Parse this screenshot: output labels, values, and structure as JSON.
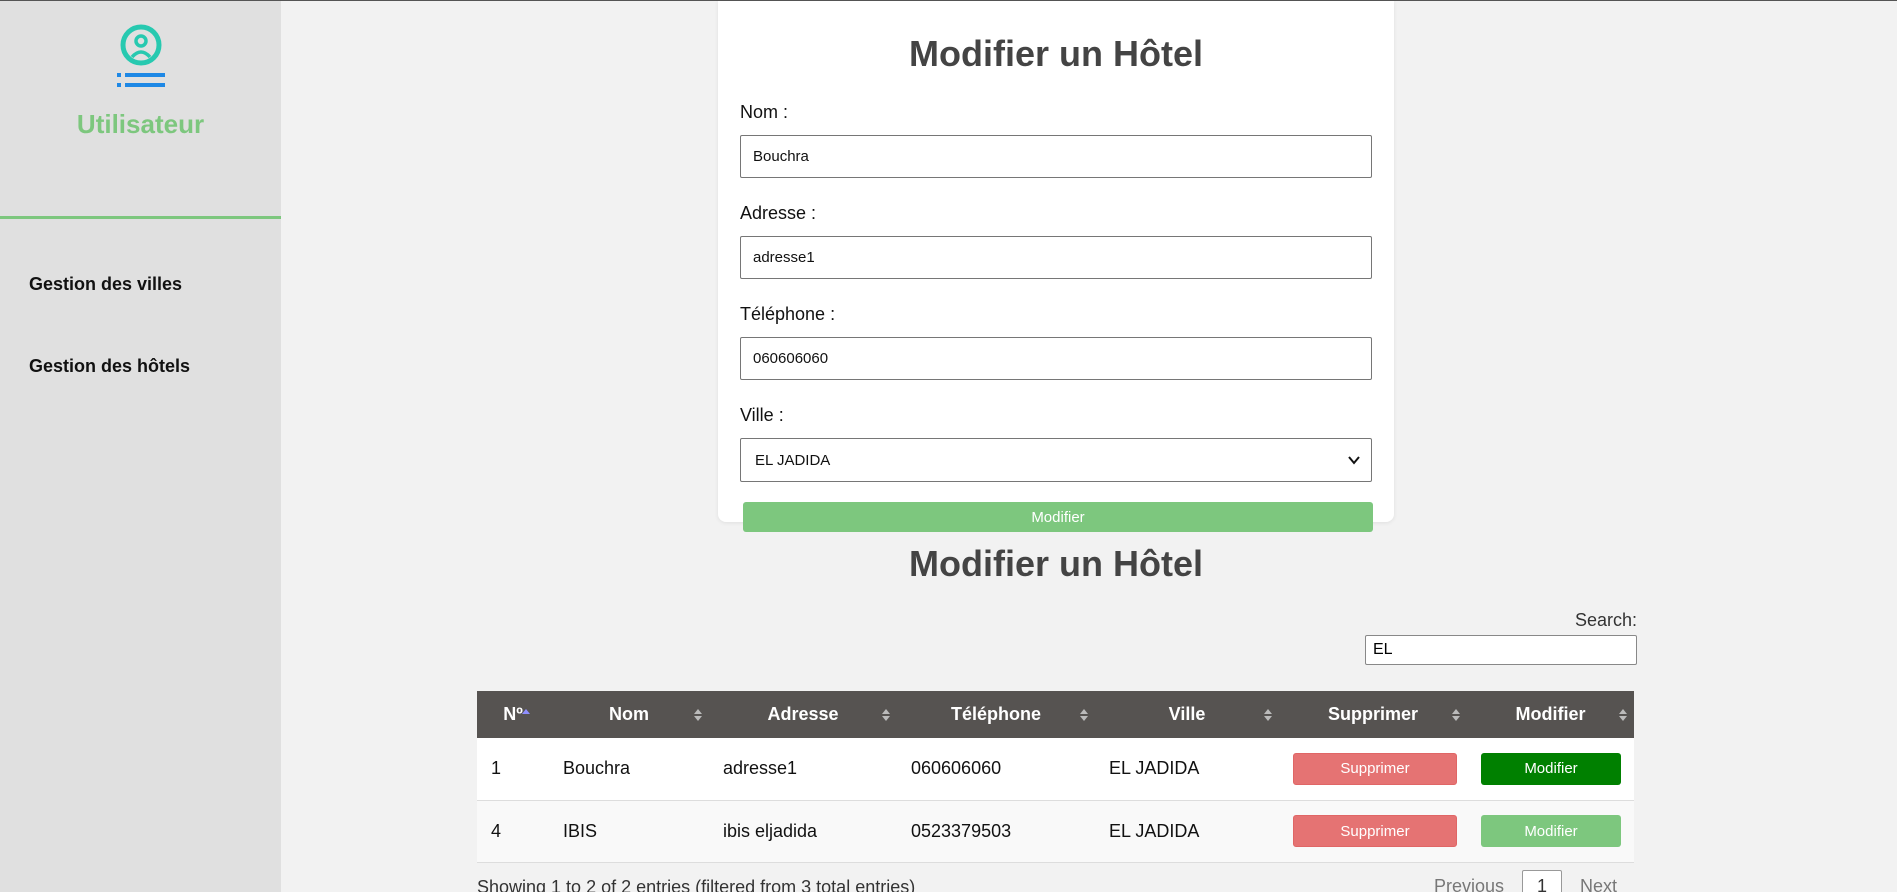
{
  "sidebar": {
    "title": "Utilisateur",
    "items": [
      {
        "label": "Gestion des villes"
      },
      {
        "label": "Gestion des hôtels"
      }
    ]
  },
  "form": {
    "title": "Modifier un Hôtel",
    "nom_label": "Nom :",
    "nom_value": "Bouchra",
    "adresse_label": "Adresse :",
    "adresse_value": "adresse1",
    "telephone_label": "Téléphone :",
    "telephone_value": "060606060",
    "ville_label": "Ville :",
    "ville_value": "EL JADIDA",
    "submit_label": "Modifier"
  },
  "table_section": {
    "title": "Modifier un Hôtel",
    "search_label": "Search:",
    "search_value": "EL",
    "columns": [
      "Nº",
      "Nom",
      "Adresse",
      "Téléphone",
      "Ville",
      "Supprimer",
      "Modifier"
    ],
    "rows": [
      {
        "num": "1",
        "nom": "Bouchra",
        "adresse": "adresse1",
        "telephone": "060606060",
        "ville": "EL JADIDA",
        "delete_label": "Supprimer",
        "edit_label": "Modifier"
      },
      {
        "num": "4",
        "nom": "IBIS",
        "adresse": "ibis eljadida",
        "telephone": "0523379503",
        "ville": "EL JADIDA",
        "delete_label": "Supprimer",
        "edit_label": "Modifier"
      }
    ],
    "info": "Showing 1 to 2 of 2 entries (filtered from 3 total entries)",
    "pager": {
      "previous": "Previous",
      "page": "1",
      "next": "Next"
    }
  },
  "colors": {
    "accent_green": "#7dc77e",
    "dark_green": "#008000",
    "danger": "#e57373",
    "header_bg": "#565351"
  }
}
